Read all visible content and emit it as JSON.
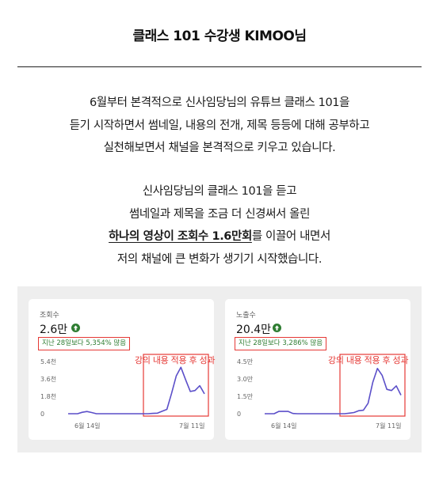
{
  "header": {
    "title": "클래스 101 수강생 KIMOO님"
  },
  "intro": {
    "lines": [
      "6월부터 본격적으로 신사임당님의 유튜브 클래스 101을",
      "듣기 시작하면서 썸네일, 내용의 전개, 제목 등등에 대해 공부하고",
      "실천해보면서 채널을 본격적으로 키우고 있습니다."
    ]
  },
  "story": {
    "line1": "신사임당님의 클래스 101을 듣고",
    "line2": "썸네일과 제목을 조금 더 신경써서 올린",
    "line3_highlight": "하나의 영상이 조회수 1.6만회",
    "line3_rest": "를 이끌어 내면서",
    "line4": "저의 채널에 큰 변화가 생기기 시작했습니다."
  },
  "colors": {
    "line": "#5b4fc9",
    "highlight_box": "#e53935",
    "positive": "#2e7d32"
  },
  "cards": [
    {
      "label": "조회수",
      "value": "2.6만",
      "trend_icon": "up-arrow-icon",
      "compare": "지난 28일보다 5,354% 많음",
      "callout": "강의 내용 적용 후 성과"
    },
    {
      "label": "노출수",
      "value": "20.4만",
      "trend_icon": "up-arrow-icon",
      "compare": "지난 28일보다 3,286% 많음",
      "callout": "강의 내용 적용 후 성과"
    }
  ],
  "chart_data": [
    {
      "type": "line",
      "x_tick_labels": [
        "6월 14일",
        "7월 11일"
      ],
      "y_ticks": [
        "0",
        "1.8천",
        "3.6천",
        "5.4천"
      ],
      "ylim": [
        0,
        5400
      ],
      "grid": false,
      "series": [
        {
          "values": [
            0,
            0,
            0,
            150,
            230,
            120,
            0,
            0,
            0,
            0,
            0,
            0,
            0,
            0,
            0,
            0,
            0,
            0,
            30,
            60,
            250,
            450,
            2100,
            3900,
            4800,
            3500,
            2300,
            2400,
            2900,
            2050
          ]
        }
      ]
    },
    {
      "type": "line",
      "x_tick_labels": [
        "6월 14일",
        "7월 11일"
      ],
      "y_ticks": [
        "0",
        "1.5만",
        "3.0만",
        "4.5만"
      ],
      "ylim": [
        0,
        45000
      ],
      "grid": false,
      "series": [
        {
          "values": [
            0,
            0,
            0,
            2000,
            2000,
            2000,
            200,
            0,
            0,
            0,
            0,
            0,
            0,
            0,
            0,
            0,
            0,
            0,
            500,
            1000,
            2600,
            3000,
            9000,
            27000,
            39000,
            33000,
            21000,
            20000,
            24000,
            16000
          ]
        }
      ]
    }
  ]
}
